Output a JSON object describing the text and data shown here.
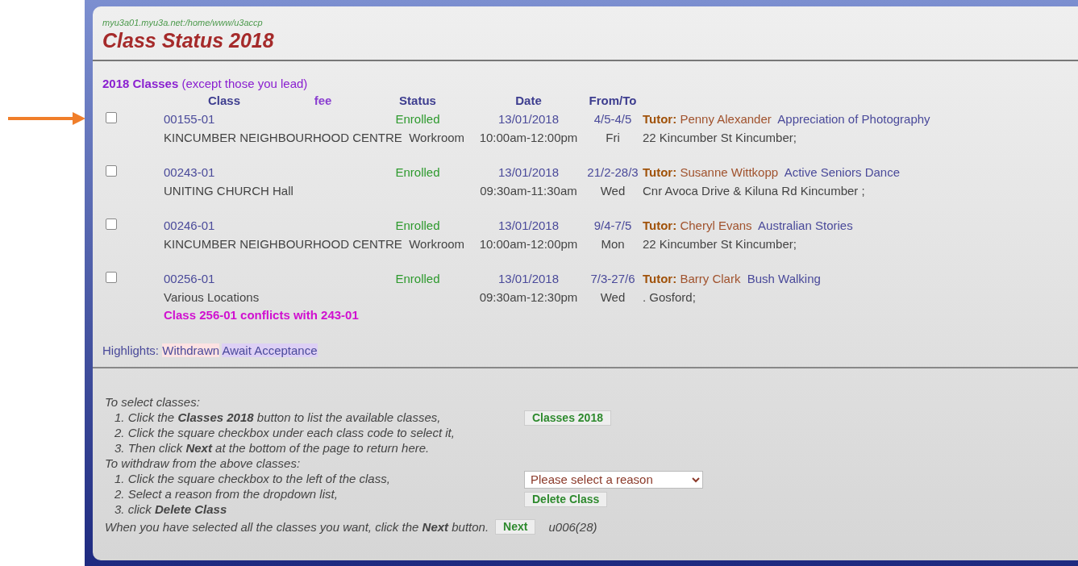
{
  "path": "myu3a01.myu3a.net:/home/www/u3accp",
  "title": "Class Status 2018",
  "section": {
    "heading": "2018 Classes",
    "note": "(except those you lead)"
  },
  "columns": [
    "Class",
    "fee",
    "Status",
    "Date",
    "From/To"
  ],
  "classes": [
    {
      "checked": false,
      "code": "00155-01",
      "status": "Enrolled",
      "date": "13/01/2018",
      "from_to": "4/5-4/5",
      "tutor_label": "Tutor:",
      "tutor": "Penny Alexander",
      "title": "Appreciation of Photography",
      "location": "KINCUMBER NEIGHBOURHOOD CENTRE  Workroom",
      "time": "10:00am-12:00pm",
      "day": "Fri",
      "address": "22 Kincumber St Kincumber;"
    },
    {
      "checked": false,
      "code": "00243-01",
      "status": "Enrolled",
      "date": "13/01/2018",
      "from_to": "21/2-28/3",
      "tutor_label": "Tutor:",
      "tutor": "Susanne Wittkopp",
      "title": "Active Seniors Dance",
      "location": "UNITING CHURCH Hall",
      "time": "09:30am-11:30am",
      "day": "Wed",
      "address": "Cnr Avoca Drive & Kiluna Rd Kincumber ;"
    },
    {
      "checked": false,
      "code": "00246-01",
      "status": "Enrolled",
      "date": "13/01/2018",
      "from_to": "9/4-7/5",
      "tutor_label": "Tutor:",
      "tutor": "Cheryl Evans",
      "title": "Australian Stories",
      "location": "KINCUMBER NEIGHBOURHOOD CENTRE  Workroom",
      "time": "10:00am-12:00pm",
      "day": "Mon",
      "address": "22 Kincumber St Kincumber;"
    },
    {
      "checked": false,
      "code": "00256-01",
      "status": "Enrolled",
      "date": "13/01/2018",
      "from_to": "7/3-27/6",
      "tutor_label": "Tutor:",
      "tutor": "Barry Clark",
      "title": "Bush Walking",
      "location": "Various Locations",
      "time": "09:30am-12:30pm",
      "day": "Wed",
      "address": ". Gosford;",
      "conflict": "Class 256-01 conflicts with 243-01"
    }
  ],
  "highlights": {
    "label": "Highlights:",
    "items": [
      {
        "label": "Withdrawn",
        "color": "#fde2e2"
      },
      {
        "label": "Await Acceptance",
        "color": "#ddd0f5"
      }
    ]
  },
  "select_help": {
    "heading": "To select classes:",
    "steps": [
      {
        "number": "1.",
        "text": "Click the **Classes 2018** button to list the available classes,"
      },
      {
        "number": "2.",
        "text": "Click the square checkbox under each class code to select it,"
      },
      {
        "number": "3.",
        "text": "Then click **Next** at the bottom of the page to return here."
      }
    ],
    "button": "Classes 2018"
  },
  "withdraw_help": {
    "heading": "To withdraw from the above classes:",
    "steps": [
      {
        "number": "1.",
        "text": "Click the square checkbox to the left of the class,"
      },
      {
        "number": "2.",
        "text": "Select a reason from the dropdown list,"
      },
      {
        "number": "3.",
        "text": "click **Delete Class**"
      }
    ],
    "reason_select": "Please select a reason",
    "button": "Delete Class"
  },
  "footer": {
    "text": "When you have selected all the classes you want, click the **Next** button.",
    "button": "Next",
    "code": "u006(28)"
  }
}
